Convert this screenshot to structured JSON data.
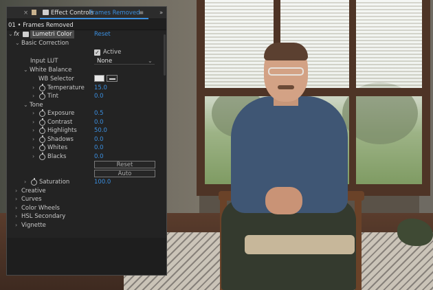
{
  "panel": {
    "close_glyph": "×",
    "menu_glyph": "≡",
    "overflow_glyph": "»",
    "tabs": [
      {
        "label": "Effect Controls",
        "active": false
      },
      {
        "label": "Frames Removed",
        "active": true
      }
    ],
    "layer_path": "01 • Frames Removed"
  },
  "effect": {
    "fx_label": "fx",
    "name": "Lumetri Color",
    "reset_label": "Reset"
  },
  "basic_correction": {
    "label": "Basic Correction",
    "active_label": "Active",
    "active_checked": true,
    "input_lut": {
      "label": "Input LUT",
      "value": "None"
    },
    "white_balance": {
      "label": "White Balance",
      "wb_selector_label": "WB Selector",
      "temperature": {
        "label": "Temperature",
        "value": "15.0"
      },
      "tint": {
        "label": "Tint",
        "value": "0.0"
      }
    },
    "tone": {
      "label": "Tone",
      "params": [
        {
          "label": "Exposure",
          "value": "0.5"
        },
        {
          "label": "Contrast",
          "value": "0.0"
        },
        {
          "label": "Highlights",
          "value": "50.0"
        },
        {
          "label": "Shadows",
          "value": "0.0"
        },
        {
          "label": "Whites",
          "value": "0.0"
        },
        {
          "label": "Blacks",
          "value": "0.0"
        }
      ],
      "reset_button": "Reset",
      "auto_button": "Auto"
    },
    "saturation": {
      "label": "Saturation",
      "value": "100.0"
    }
  },
  "sections": [
    "Creative",
    "Curves",
    "Color Wheels",
    "HSL Secondary",
    "Vignette"
  ],
  "colors": {
    "accent": "#3b8fe0",
    "panel_bg": "#232323",
    "text": "#c8c8c8"
  }
}
